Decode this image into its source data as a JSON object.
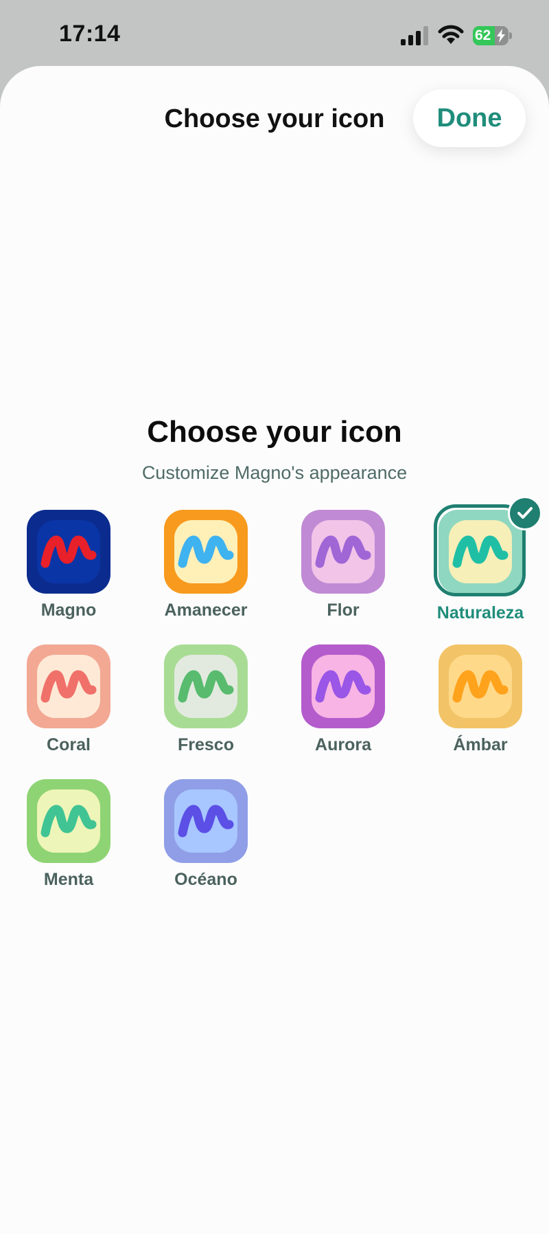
{
  "status_bar": {
    "time": "17:14",
    "battery_percent": "62",
    "battery_level": 0.62,
    "charging": true
  },
  "header": {
    "title": "Choose your icon",
    "done_label": "Done"
  },
  "main": {
    "title": "Choose your icon",
    "subtitle": "Customize Magno's appearance"
  },
  "colors": {
    "accent": "#208d7b",
    "label": "#4b625d"
  },
  "icons": [
    {
      "label": "Magno",
      "bg": "#0b2c8e",
      "inner": "#0a35a6",
      "glyph": "#e8202a",
      "selected": false
    },
    {
      "label": "Amanecer",
      "bg": "#f79a1e",
      "inner": "#fff0b8",
      "glyph": "#3fb2f0",
      "selected": false
    },
    {
      "label": "Flor",
      "bg": "#c08ad4",
      "inner": "#f2c4e8",
      "glyph": "#a066d6",
      "selected": false
    },
    {
      "label": "Naturaleza",
      "bg": "#8fd7c0",
      "inner": "#f6efb8",
      "glyph": "#1fbfa6",
      "selected": true
    },
    {
      "label": "Coral",
      "bg": "#f2a892",
      "inner": "#fde9d6",
      "glyph": "#f0706a",
      "selected": false
    },
    {
      "label": "Fresco",
      "bg": "#a8dc94",
      "inner": "#e2eadf",
      "glyph": "#58bb6e",
      "selected": false
    },
    {
      "label": "Aurora",
      "bg": "#b45ccc",
      "inner": "#f8b4e4",
      "glyph": "#9a56e6",
      "selected": false
    },
    {
      "label": "Ámbar",
      "bg": "#f2c467",
      "inner": "#ffd98a",
      "glyph": "#ffa21c",
      "selected": false
    },
    {
      "label": "Menta",
      "bg": "#8fd474",
      "inner": "#eef5b8",
      "glyph": "#40c494",
      "selected": false
    },
    {
      "label": "Océano",
      "bg": "#8f9ee6",
      "inner": "#a8c6ff",
      "glyph": "#5b4fe6",
      "selected": false
    }
  ]
}
